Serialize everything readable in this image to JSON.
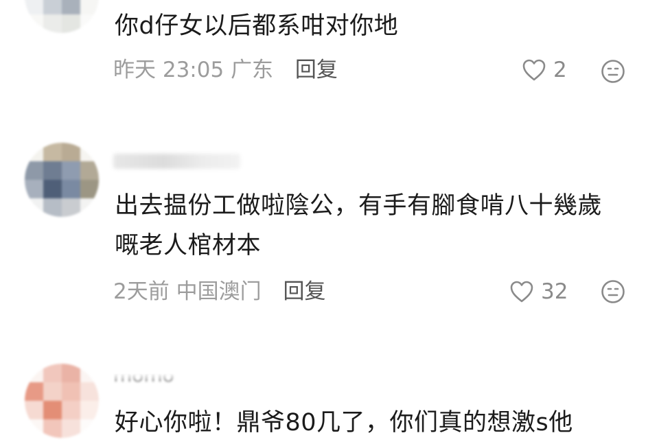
{
  "comments": [
    {
      "text": "你d仔女以后都系咁对你地",
      "time": "昨天 23:05",
      "location": "广东",
      "reply_label": "回复",
      "likes": "2"
    },
    {
      "text_line1": "出去揾份工做啦陰公，有手有腳食啃八十幾歲",
      "text_line2": "嘅老人棺材本",
      "time": "2天前",
      "location": "中国澳门",
      "reply_label": "回复",
      "likes": "32"
    },
    {
      "username_fragment": "momo",
      "text": "好心你啦！鼎爷80几了，你们真的想激s他"
    }
  ],
  "icons": {
    "like": "heart-outline-icon",
    "dislike": "neutral-face-icon"
  },
  "colors": {
    "text": "#1b1b1b",
    "meta": "#9c9c9c",
    "reply": "#555555",
    "icon": "#8a8a8a"
  }
}
